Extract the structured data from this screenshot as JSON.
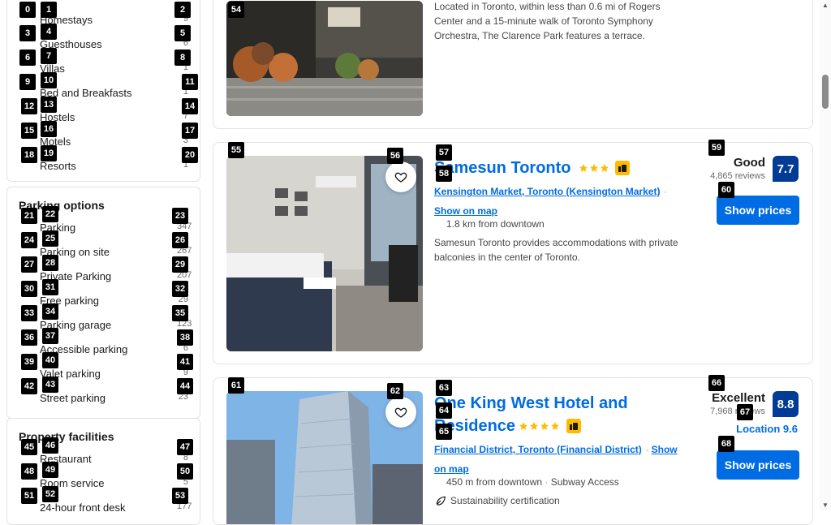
{
  "filters": {
    "property_types": {
      "items": [
        {
          "label": "Homestays",
          "count": "9"
        },
        {
          "label": "Guesthouses",
          "count": "6"
        },
        {
          "label": "Villas",
          "count": "1"
        },
        {
          "label": "Bed and Breakfasts",
          "count": "1"
        },
        {
          "label": "Hostels",
          "count": "7"
        },
        {
          "label": "Motels",
          "count": "3"
        },
        {
          "label": "Resorts",
          "count": "1"
        }
      ]
    },
    "parking": {
      "title": "Parking options",
      "items": [
        {
          "label": "Parking",
          "count": "347"
        },
        {
          "label": "Parking on site",
          "count": "267"
        },
        {
          "label": "Private Parking",
          "count": "207"
        },
        {
          "label": "Free parking",
          "count": "29"
        },
        {
          "label": "Parking garage",
          "count": "123"
        },
        {
          "label": "Accessible parking",
          "count": "6"
        },
        {
          "label": "Valet parking",
          "count": "9"
        },
        {
          "label": "Street parking",
          "count": "23"
        }
      ]
    },
    "facilities": {
      "title": "Property facilities",
      "items": [
        {
          "label": "Restaurant",
          "count": "8"
        },
        {
          "label": "Room service",
          "count": "5"
        },
        {
          "label": "24-hour front desk",
          "count": "177"
        }
      ]
    }
  },
  "properties": [
    {
      "description": "Located in Toronto, within less than 0.6 mi of Rogers Center and a 15-minute walk of Toronto Symphony Orchestra, The Clarence Park features a terrace."
    },
    {
      "name": "Samesun Toronto",
      "stars": 3,
      "location": "Kensington Market, Toronto (Kensington Market)",
      "map_link": "Show on map",
      "distance": "1.8 km from downtown",
      "description": "Samesun Toronto provides accommodations with private balconies in the center of Toronto.",
      "score_word": "Good",
      "reviews": "4,865 reviews",
      "score": "7.7",
      "button": "Show prices"
    },
    {
      "name_line1": "One King West Hotel and",
      "name_line2": "Residence",
      "stars": 4,
      "location": "Financial District, Toronto (Financial District)",
      "map_link": "Show on map",
      "distance": "450 m from downtown",
      "transit": "Subway Access",
      "sustainability": "Sustainability certification",
      "score_word": "Excellent",
      "reviews": "7,968 reviews",
      "score": "8.8",
      "sub_score": "Location 9.6",
      "button": "Show prices"
    }
  ],
  "colors": {
    "link_blue": "#006ce4",
    "score_blue": "#003b95",
    "star_yellow": "#febb02"
  }
}
